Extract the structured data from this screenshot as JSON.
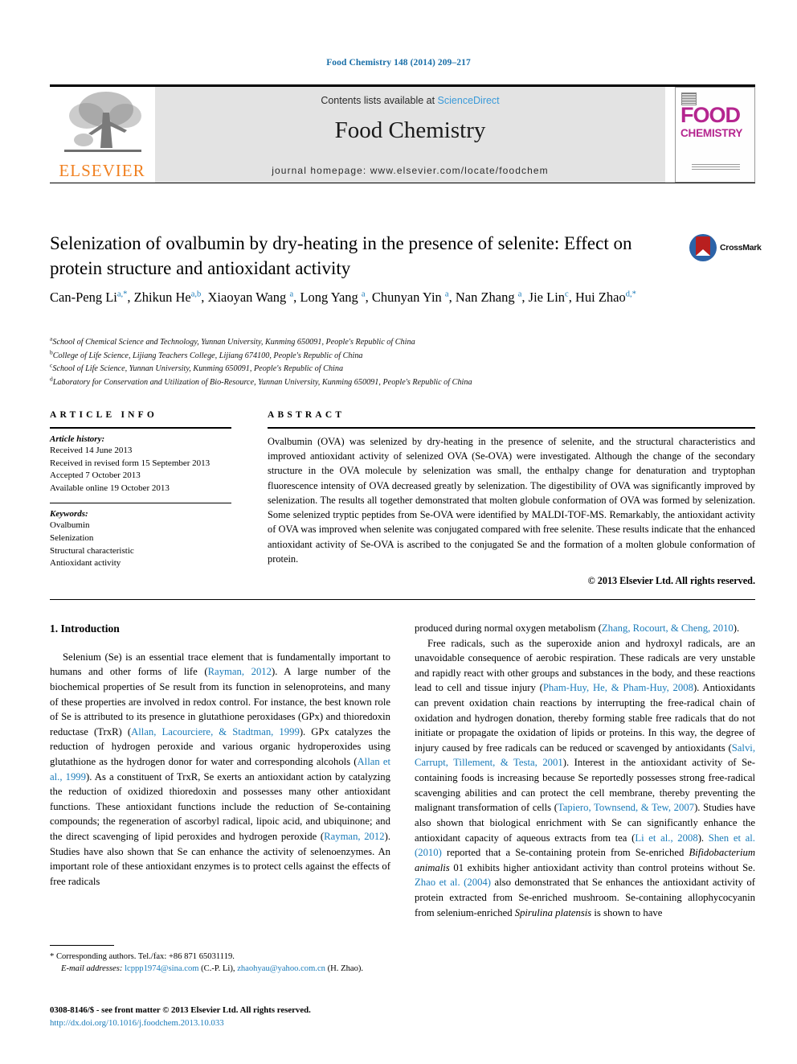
{
  "running_head": "Food Chemistry 148 (2014) 209–217",
  "journal_header": {
    "contents_prefix": "Contents lists available at ",
    "sciencedirect": "ScienceDirect",
    "journal_name": "Food Chemistry",
    "homepage": "journal homepage: www.elsevier.com/locate/foodchem",
    "publisher_logo_text": "ELSEVIER",
    "cover_title_line1": "FOOD",
    "cover_title_line2": "CHEMISTRY",
    "accent_color": "#3a9ad9",
    "cover_color": "#b5258f",
    "elsevier_color": "#f08020"
  },
  "crossmark": {
    "label": "CrossMark"
  },
  "article": {
    "title": "Selenization of ovalbumin by dry-heating in the presence of selenite: Effect on protein structure and antioxidant activity",
    "authors_html": "Can-Peng Li<sup>a,*</sup>, Zhikun He<sup>a,b</sup>, Xiaoyan Wang <sup>a</sup>, Long Yang <sup>a</sup>, Chunyan Yin <sup>a</sup>, Nan Zhang <sup>a</sup>, Jie Lin<sup>c</sup>, Hui Zhao<sup>d,*</sup>",
    "affiliations": [
      {
        "marker": "a",
        "text": "School of Chemical Science and Technology, Yunnan University, Kunming 650091, People's Republic of China"
      },
      {
        "marker": "b",
        "text": "College of Life Science, Lijiang Teachers College, Lijiang 674100, People's Republic of China"
      },
      {
        "marker": "c",
        "text": "School of Life Science, Yunnan University, Kunming 650091, People's Republic of China"
      },
      {
        "marker": "d",
        "text": "Laboratory for Conservation and Utilization of Bio-Resource, Yunnan University, Kunming 650091, People's Republic of China"
      }
    ]
  },
  "article_info": {
    "heading": "ARTICLE INFO",
    "history_label": "Article history:",
    "history": [
      "Received 14 June 2013",
      "Received in revised form 15 September 2013",
      "Accepted 7 October 2013",
      "Available online 19 October 2013"
    ],
    "keywords_label": "Keywords:",
    "keywords": [
      "Ovalbumin",
      "Selenization",
      "Structural characteristic",
      "Antioxidant activity"
    ]
  },
  "abstract": {
    "heading": "ABSTRACT",
    "text": "Ovalbumin (OVA) was selenized by dry-heating in the presence of selenite, and the structural characteristics and improved antioxidant activity of selenized OVA (Se-OVA) were investigated. Although the change of the secondary structure in the OVA molecule by selenization was small, the enthalpy change for denaturation and tryptophan fluorescence intensity of OVA decreased greatly by selenization. The digestibility of OVA was significantly improved by selenization. The results all together demonstrated that molten globule conformation of OVA was formed by selenization. Some selenized tryptic peptides from Se-OVA were identified by MALDI-TOF-MS. Remarkably, the antioxidant activity of OVA was improved when selenite was conjugated compared with free selenite. These results indicate that the enhanced antioxidant activity of Se-OVA is ascribed to the conjugated Se and the formation of a molten globule conformation of protein.",
    "copyright": "© 2013 Elsevier Ltd. All rights reserved."
  },
  "body": {
    "section_heading": "1. Introduction",
    "left_paragraph_1_html": "Selenium (Se) is an essential trace element that is fundamentally important to humans and other forms of life (<span class=\"ref\">Rayman, 2012</span>). A large number of the biochemical properties of Se result from its function in selenoproteins, and many of these properties are involved in redox control. For instance, the best known role of Se is attributed to its presence in glutathione peroxidases (GPx) and thioredoxin reductase (TrxR) (<span class=\"ref\">Allan, Lacourciere, &amp; Stadtman, 1999</span>). GPx catalyzes the reduction of hydrogen peroxide and various organic hydroperoxides using glutathione as the hydrogen donor for water and corresponding alcohols (<span class=\"ref\">Allan et al., 1999</span>). As a constituent of TrxR, Se exerts an antioxidant action by catalyzing the reduction of oxidized thioredoxin and possesses many other antioxidant functions. These antioxidant functions include the reduction of Se-containing compounds; the regeneration of ascorbyl radical, lipoic acid, and ubiquinone; and the direct scavenging of lipid peroxides and hydrogen peroxide (<span class=\"ref\">Rayman, 2012</span>). Studies have also shown that Se can enhance the activity of selenoenzymes. An important role of these antioxidant enzymes is to protect cells against the effects of free radicals",
    "right_paragraph_1_html": "produced during normal oxygen metabolism (<span class=\"ref\">Zhang, Rocourt, &amp; Cheng, 2010</span>).",
    "right_paragraph_2_html": "Free radicals, such as the superoxide anion and hydroxyl radicals, are an unavoidable consequence of aerobic respiration. These radicals are very unstable and rapidly react with other groups and substances in the body, and these reactions lead to cell and tissue injury (<span class=\"ref\">Pham-Huy, He, &amp; Pham-Huy, 2008</span>). Antioxidants can prevent oxidation chain reactions by interrupting the free-radical chain of oxidation and hydrogen donation, thereby forming stable free radicals that do not initiate or propagate the oxidation of lipids or proteins. In this way, the degree of injury caused by free radicals can be reduced or scavenged by antioxidants (<span class=\"ref\">Salvi, Carrupt, Tillement, &amp; Testa, 2001</span>). Interest in the antioxidant activity of Se-containing foods is increasing because Se reportedly possesses strong free-radical scavenging abilities and can protect the cell membrane, thereby preventing the malignant transformation of cells (<span class=\"ref\">Tapiero, Townsend, &amp; Tew, 2007</span>). Studies have also shown that biological enrichment with Se can significantly enhance the antioxidant capacity of aqueous extracts from tea (<span class=\"ref\">Li et al., 2008</span>). <span class=\"ref\">Shen et al. (2010)</span> reported that a Se-containing protein from Se-enriched <span class=\"ital\">Bifidobacterium animalis</span> 01 exhibits higher antioxidant activity than control proteins without Se. <span class=\"ref\">Zhao et al. (2004)</span> also demonstrated that Se enhances the antioxidant activity of protein extracted from Se-enriched mushroom. Se-containing allophycocyanin from selenium-enriched <span class=\"ital\">Spirulina platensis</span> is shown to have"
  },
  "footnotes": {
    "corresponding_html": "<span class=\"star\">*</span> Corresponding authors. Tel./fax: +86 871 65031119.",
    "email_label": "E-mail addresses:",
    "email_1": "lcppp1974@sina.com",
    "email_1_owner": "(C.-P. Li),",
    "email_2": "zhaohyau@yahoo.com.cn",
    "email_2_owner": "(H. Zhao).",
    "issn_line": "0308-8146/$ - see front matter © 2013 Elsevier Ltd. All rights reserved.",
    "doi": "http://dx.doi.org/10.1016/j.foodchem.2013.10.033"
  }
}
